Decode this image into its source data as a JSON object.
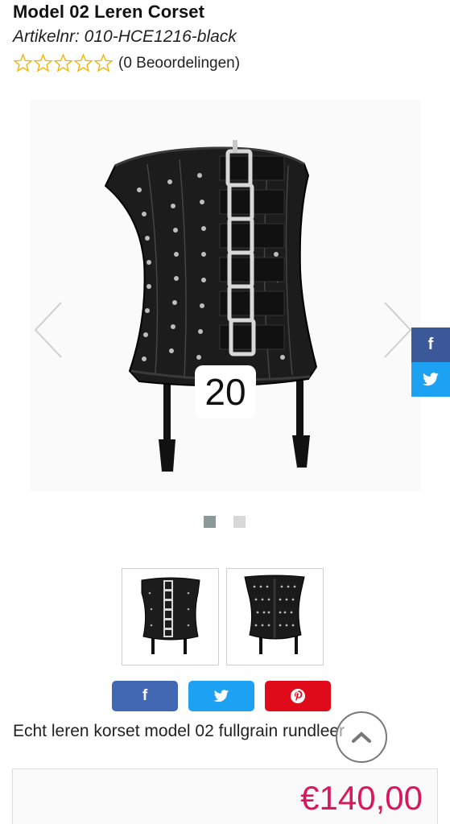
{
  "product": {
    "title": "Model 02 Leren Corset",
    "sku": "Artikelnr: 010-HCE1216-black",
    "rating_stars": 0,
    "rating_max": 5,
    "reviews_label": "(0 Beoordelingen)",
    "description": "Echt leren korset model 02 fullgrain rundleer",
    "price": "€140,00"
  },
  "gallery": {
    "badge": "20",
    "slide_count": 2,
    "active_slide": 1,
    "prev_icon": "chevron-left-icon",
    "next_icon": "chevron-right-icon"
  },
  "side_share": {
    "facebook_label": "f",
    "twitter_icon": "twitter-bird-icon"
  },
  "share_buttons": {
    "facebook_label": "f",
    "twitter_icon": "twitter-bird-icon",
    "pinterest_icon": "pinterest-icon"
  },
  "colors": {
    "price": "#d8175c",
    "facebook": "#3b5998",
    "twitter": "#1da1f2",
    "pinterest": "#e00b1a",
    "star_outline": "#f0b400"
  }
}
